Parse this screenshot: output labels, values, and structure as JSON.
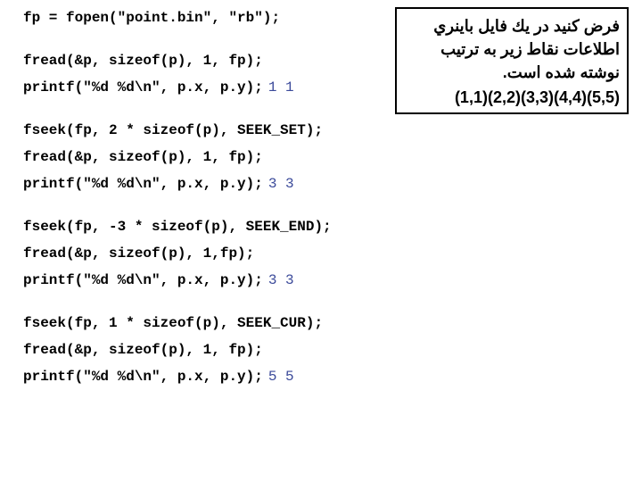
{
  "code": {
    "l1": "fp = fopen(\"point.bin\", \"rb\");",
    "l2": "fread(&p, sizeof(p), 1, fp);",
    "l3": "printf(\"%d %d\\n\", p.x, p.y);",
    "o3": "1 1",
    "l4": "fseek(fp, 2 * sizeof(p), SEEK_SET);",
    "l5": "fread(&p, sizeof(p), 1, fp);",
    "l6": "printf(\"%d %d\\n\", p.x, p.y);",
    "o6": "3 3",
    "l7": "fseek(fp, -3 * sizeof(p), SEEK_END);",
    "l8": "fread(&p, sizeof(p), 1,fp);",
    "l9": "printf(\"%d %d\\n\", p.x, p.y);",
    "o9": "3 3",
    "l10": "fseek(fp, 1 * sizeof(p), SEEK_CUR);",
    "l11": "fread(&p, sizeof(p), 1, fp);",
    "l12": "printf(\"%d %d\\n\", p.x, p.y);",
    "o12": "5 5"
  },
  "note": {
    "line1": "فرض كنيد در يك فايل باينري",
    "line2": "اطلاعات نقاط زير به ترتيب",
    "line3": "نوشته شده است.",
    "coords": "(1,1)(2,2)(3,3)(4,4)(5,5)"
  }
}
